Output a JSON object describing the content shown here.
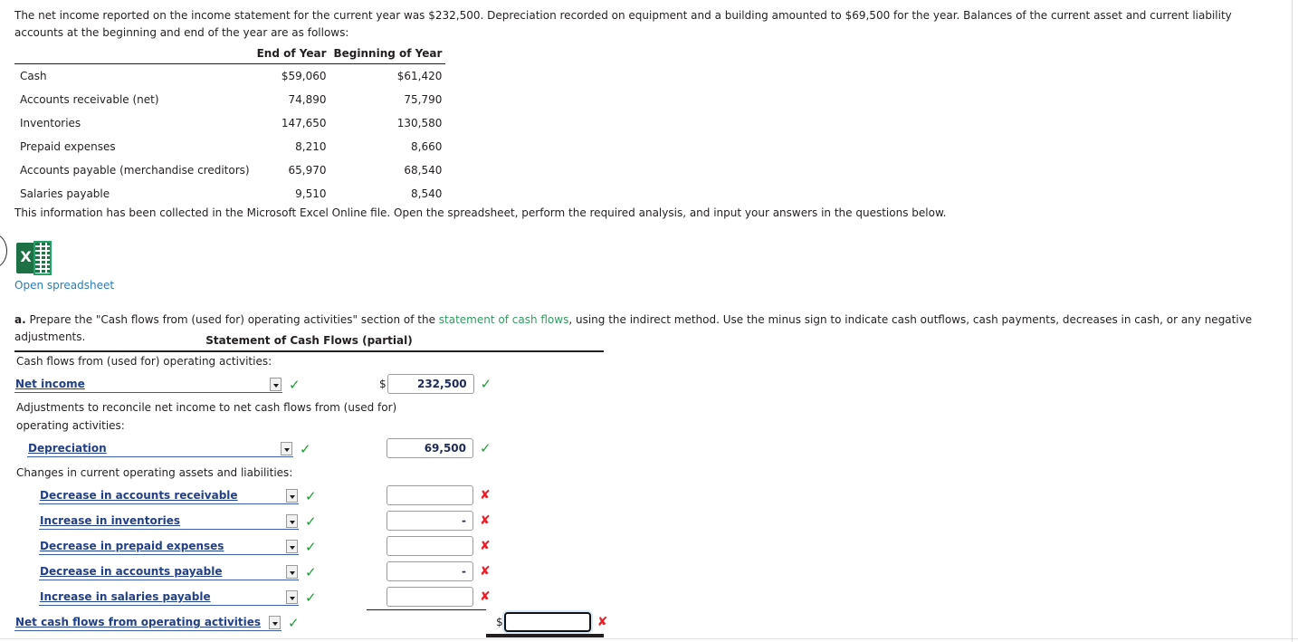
{
  "intro": {
    "paragraph": "The net income reported on the income statement for the current year was $232,500. Depreciation recorded on equipment and a building amounted to $69,500 for the year. Balances of the current asset and current liability accounts at the beginning and end of the year are as follows:"
  },
  "balances_table": {
    "columns": [
      "",
      "End of Year",
      "Beginning of Year"
    ],
    "rows": [
      {
        "item": "Cash",
        "end_of_year": "$59,060",
        "beginning_of_year": "$61,420"
      },
      {
        "item": "Accounts receivable (net)",
        "end_of_year": "74,890",
        "beginning_of_year": "75,790"
      },
      {
        "item": "Inventories",
        "end_of_year": "147,650",
        "beginning_of_year": "130,580"
      },
      {
        "item": "Prepaid expenses",
        "end_of_year": "8,210",
        "beginning_of_year": "8,660"
      },
      {
        "item": "Accounts payable (merchandise creditors)",
        "end_of_year": "65,970",
        "beginning_of_year": "68,540"
      },
      {
        "item": "Salaries payable",
        "end_of_year": "9,510",
        "beginning_of_year": "8,540"
      }
    ]
  },
  "collected_note": "This information has been collected in the Microsoft Excel Online file. Open the spreadsheet, perform the required analysis, and input your answers in the questions below.",
  "spreadsheet": {
    "icon": "excel-icon",
    "link_label": "Open spreadsheet"
  },
  "requirement_a": {
    "label": "a.",
    "text_before_link": "Prepare the \"Cash flows from (used for) operating activities\" section of the ",
    "glossary_link": "statement of cash flows",
    "text_after_link": ", using the indirect method. Use the minus sign to indicate cash outflows, cash payments, decreases in cash, or any negative adjustments."
  },
  "statement": {
    "title": "Statement of Cash Flows (partial)",
    "section_label": "Cash flows from (used for) operating activities:",
    "adjustments_label_line1": "Adjustments to reconcile net income to net cash flows from (used for)",
    "adjustments_label_line2": "operating activities:",
    "changes_label": "Changes in current operating assets and liabilities:",
    "rows": [
      {
        "id": "net-income",
        "select_value": "Net income",
        "select_status": "correct",
        "has_dollar": true,
        "amount": "232,500",
        "amount_status": "correct",
        "focused": false,
        "indent": 0,
        "select_width": 296
      },
      {
        "id": "depreciation",
        "select_value": "Depreciation",
        "select_status": "correct",
        "has_dollar": false,
        "amount": "69,500",
        "amount_status": "correct",
        "focused": false,
        "indent": 14,
        "select_width": 294
      },
      {
        "id": "decrease-accounts-receivable",
        "select_value": "Decrease in accounts receivable",
        "select_status": "correct",
        "has_dollar": false,
        "amount": "",
        "amount_status": "wrong",
        "focused": false,
        "indent": 27,
        "select_width": 287
      },
      {
        "id": "increase-inventories",
        "select_value": "Increase in inventories",
        "select_status": "correct",
        "has_dollar": false,
        "amount": "-",
        "amount_status": "wrong",
        "focused": false,
        "indent": 27,
        "select_width": 287
      },
      {
        "id": "decrease-prepaid-expenses",
        "select_value": "Decrease in prepaid expenses",
        "select_status": "correct",
        "has_dollar": false,
        "amount": "",
        "amount_status": "wrong",
        "focused": false,
        "indent": 27,
        "select_width": 287
      },
      {
        "id": "decrease-accounts-payable",
        "select_value": "Decrease in accounts payable",
        "select_status": "correct",
        "has_dollar": false,
        "amount": "-",
        "amount_status": "wrong",
        "focused": false,
        "indent": 27,
        "select_width": 287
      },
      {
        "id": "increase-salaries-payable",
        "select_value": "Increase in salaries payable",
        "select_status": "correct",
        "has_dollar": false,
        "amount": "",
        "amount_status": "wrong",
        "focused": false,
        "indent": 27,
        "select_width": 287
      },
      {
        "id": "net-cash-flows-operating",
        "select_value": "Net cash flows from operating activities",
        "select_status": "correct",
        "has_dollar": true,
        "amount": "",
        "amount_status": "wrong",
        "focused": true,
        "indent": 0,
        "select_width": 295
      }
    ]
  },
  "glyphs": {
    "correct": "✓",
    "wrong": "✘",
    "dollar": "$"
  },
  "colors": {
    "correct_green": "#1f9d38",
    "wrong_red": "#e8202a",
    "select_blue": "#20408a",
    "link_blue": "#2b7bba",
    "glossary_green": "#2f9e5f",
    "excel_green": "#1e7145"
  }
}
